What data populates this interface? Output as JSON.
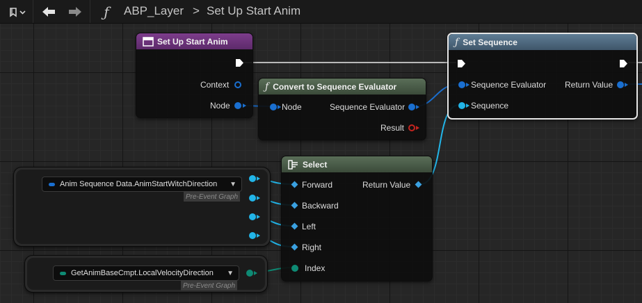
{
  "breadcrumb": {
    "blueprint": "ABP_Layer",
    "separator": ">",
    "function": "Set Up Start Anim"
  },
  "colors": {
    "entry_header": "#6e2f7c",
    "function_header": "#4d6a80",
    "pure_header": "#4a5c48",
    "object_pin": "#1a6fd0",
    "struct_pin": "#22b5e8",
    "result_pin": "#c4241f",
    "index_pin": "#0e8a74",
    "wire_white": "#ffffff"
  },
  "nodes": {
    "entry": {
      "title": "Set Up Start Anim",
      "icon": "function-entry-icon",
      "pins": {
        "context": "Context",
        "node": "Node"
      }
    },
    "convert": {
      "title": "Convert to Sequence Evaluator",
      "icon": "function-icon",
      "pins": {
        "node": "Node",
        "sequence_evaluator": "Sequence Evaluator",
        "result": "Result"
      }
    },
    "set_sequence": {
      "title": "Set Sequence",
      "icon": "function-icon",
      "pins": {
        "sequence_evaluator": "Sequence Evaluator",
        "sequence": "Sequence",
        "return_value": "Return Value"
      }
    },
    "select": {
      "title": "Select",
      "icon": "select-icon",
      "pins": {
        "forward": "Forward",
        "backward": "Backward",
        "left": "Left",
        "right": "Right",
        "index": "Index",
        "return_value": "Return Value"
      }
    },
    "anim_data": {
      "value": "Anim Sequence Data.AnimStartWitchDirection",
      "tag": "Pre-Event Graph"
    },
    "velocity_dir": {
      "value": "GetAnimBaseCmpt.LocalVelocityDirection",
      "tag": "Pre-Event Graph"
    }
  }
}
